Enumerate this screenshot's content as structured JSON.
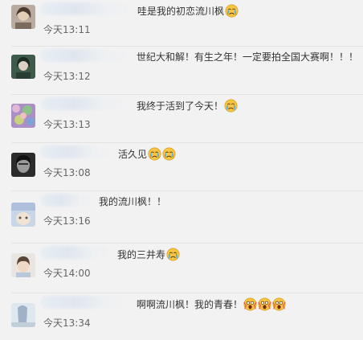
{
  "comments": [
    {
      "text": "哇是我的初恋流川枫",
      "time": "今天13:11",
      "emojis": [
        "crying-face"
      ]
    },
    {
      "text": "世纪大和解！有生之年！一定要拍全国大赛啊！！！",
      "time": "今天13:12",
      "emojis": []
    },
    {
      "text": "我终于活到了今天！",
      "time": "今天13:13",
      "emojis": [
        "crying-face"
      ]
    },
    {
      "text": "活久见",
      "time": "今天13:08",
      "emojis": [
        "crying-face",
        "crying-face"
      ]
    },
    {
      "text": "我的流川枫！！",
      "time": "今天13:16",
      "emojis": []
    },
    {
      "text": "我的三井寿",
      "time": "今天14:00",
      "emojis": [
        "crying-face"
      ]
    },
    {
      "text": "啊啊流川枫！我的青春！",
      "time": "今天13:34",
      "emojis": [
        "screaming-face",
        "screaming-face",
        "screaming-face"
      ]
    }
  ],
  "colors": {
    "background": "#f2f2f2",
    "text": "#333333",
    "time": "#666666",
    "divider": "#e2e2e2",
    "emoji_face": "#f7c542",
    "emoji_tear": "#4aa8e8"
  }
}
